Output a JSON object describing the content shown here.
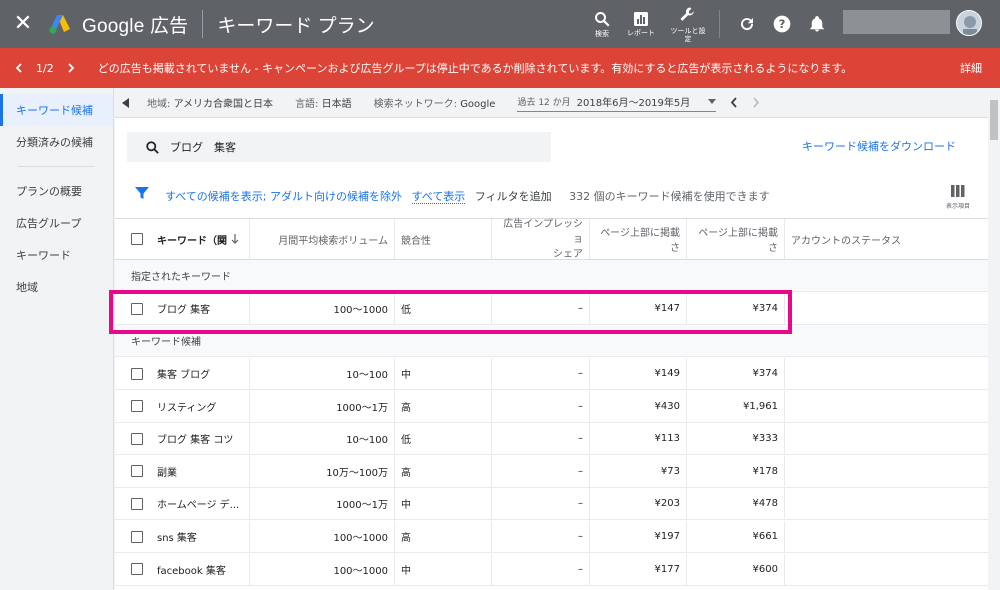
{
  "header": {
    "close_glyph": "✕",
    "brand": "Google 広告",
    "title": "キーワード プラン",
    "tools": [
      {
        "name": "search",
        "label": "検索"
      },
      {
        "name": "report",
        "label": "レポート"
      },
      {
        "name": "tools",
        "label": "ツールと設定"
      }
    ]
  },
  "alert": {
    "pager": "1/2",
    "message": "どの広告も掲載されていません - キャンペーンおよび広告グループは停止中であるか削除されています。有効にすると広告が表示されるようになります。",
    "detail": "詳細"
  },
  "sidebar": {
    "items_top": [
      "キーワード候補",
      "分類済みの候補"
    ],
    "items_bottom": [
      "プランの概要",
      "広告グループ",
      "キーワード",
      "地域"
    ]
  },
  "filterbar": {
    "location_key": "地域:",
    "location_val": "アメリカ合衆国と日本",
    "lang_key": "言語:",
    "lang_val": "日本語",
    "network_key": "検索ネットワーク:",
    "network_val": "Google",
    "period_key": "過去 12 か月",
    "period_val": "2018年6月～2019年5月"
  },
  "search": {
    "query": "ブログ　集客",
    "download": "キーワード候補をダウンロード"
  },
  "filters": {
    "show_all": "すべての候補を表示;",
    "exclude_adult": "アダルト向けの候補を除外",
    "show_all_link": "すべて表示",
    "add_filter": "フィルタを追加",
    "count": "332 個のキーワード候補を使用できます",
    "columns_label": "表示項目"
  },
  "table": {
    "headers": {
      "keyword": "キーワード（関",
      "volume": "月間平均検索ボリューム",
      "competition": "競合性",
      "impression_1": "広告インプレッショ",
      "impression_2": "シェア",
      "top_low": "ページ上部に掲載さ",
      "top_high": "ページ上部に掲載さ",
      "status": "アカウントのステータス"
    },
    "group_specified": "指定されたキーワード",
    "group_ideas": "キーワード候補",
    "specified": [
      {
        "kw": "ブログ 集客",
        "vol": "100～1000",
        "comp": "低",
        "imp": "–",
        "low": "¥147",
        "high": "¥374"
      }
    ],
    "ideas": [
      {
        "kw": "集客 ブログ",
        "vol": "10～100",
        "comp": "中",
        "imp": "–",
        "low": "¥149",
        "high": "¥374"
      },
      {
        "kw": "リスティング",
        "vol": "1000～1万",
        "comp": "高",
        "imp": "–",
        "low": "¥430",
        "high": "¥1,961"
      },
      {
        "kw": "ブログ 集客 コツ",
        "vol": "10～100",
        "comp": "低",
        "imp": "–",
        "low": "¥113",
        "high": "¥333"
      },
      {
        "kw": "副業",
        "vol": "10万～100万",
        "comp": "高",
        "imp": "–",
        "low": "¥73",
        "high": "¥178"
      },
      {
        "kw": "ホームページ デ...",
        "vol": "1000～1万",
        "comp": "中",
        "imp": "–",
        "low": "¥203",
        "high": "¥478"
      },
      {
        "kw": "sns 集客",
        "vol": "100～1000",
        "comp": "高",
        "imp": "–",
        "low": "¥197",
        "high": "¥661"
      },
      {
        "kw": "facebook 集客",
        "vol": "100～1000",
        "comp": "中",
        "imp": "–",
        "low": "¥177",
        "high": "¥600"
      }
    ]
  },
  "colors": {
    "alert": "#db4437",
    "header": "#5f6368",
    "accent": "#1a73e8",
    "highlight": "#e8088a"
  }
}
